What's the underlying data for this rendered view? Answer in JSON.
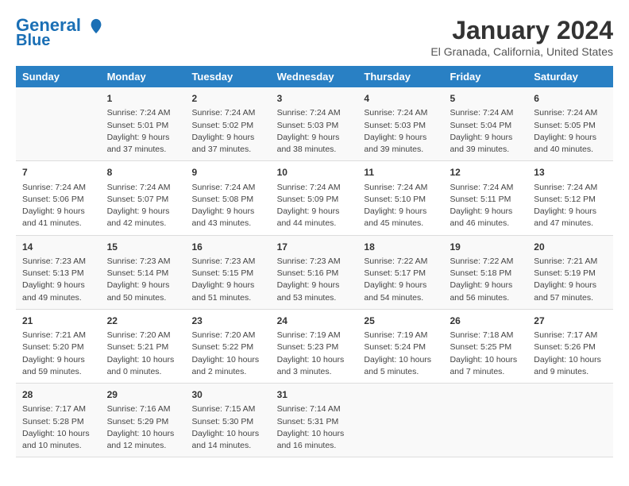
{
  "header": {
    "logo_line1": "General",
    "logo_line2": "Blue",
    "month": "January 2024",
    "location": "El Granada, California, United States"
  },
  "days_of_week": [
    "Sunday",
    "Monday",
    "Tuesday",
    "Wednesday",
    "Thursday",
    "Friday",
    "Saturday"
  ],
  "weeks": [
    [
      {
        "day": "",
        "sunrise": "",
        "sunset": "",
        "daylight": ""
      },
      {
        "day": "1",
        "sunrise": "Sunrise: 7:24 AM",
        "sunset": "Sunset: 5:01 PM",
        "daylight": "Daylight: 9 hours and 37 minutes."
      },
      {
        "day": "2",
        "sunrise": "Sunrise: 7:24 AM",
        "sunset": "Sunset: 5:02 PM",
        "daylight": "Daylight: 9 hours and 37 minutes."
      },
      {
        "day": "3",
        "sunrise": "Sunrise: 7:24 AM",
        "sunset": "Sunset: 5:03 PM",
        "daylight": "Daylight: 9 hours and 38 minutes."
      },
      {
        "day": "4",
        "sunrise": "Sunrise: 7:24 AM",
        "sunset": "Sunset: 5:03 PM",
        "daylight": "Daylight: 9 hours and 39 minutes."
      },
      {
        "day": "5",
        "sunrise": "Sunrise: 7:24 AM",
        "sunset": "Sunset: 5:04 PM",
        "daylight": "Daylight: 9 hours and 39 minutes."
      },
      {
        "day": "6",
        "sunrise": "Sunrise: 7:24 AM",
        "sunset": "Sunset: 5:05 PM",
        "daylight": "Daylight: 9 hours and 40 minutes."
      }
    ],
    [
      {
        "day": "7",
        "sunrise": "Sunrise: 7:24 AM",
        "sunset": "Sunset: 5:06 PM",
        "daylight": "Daylight: 9 hours and 41 minutes."
      },
      {
        "day": "8",
        "sunrise": "Sunrise: 7:24 AM",
        "sunset": "Sunset: 5:07 PM",
        "daylight": "Daylight: 9 hours and 42 minutes."
      },
      {
        "day": "9",
        "sunrise": "Sunrise: 7:24 AM",
        "sunset": "Sunset: 5:08 PM",
        "daylight": "Daylight: 9 hours and 43 minutes."
      },
      {
        "day": "10",
        "sunrise": "Sunrise: 7:24 AM",
        "sunset": "Sunset: 5:09 PM",
        "daylight": "Daylight: 9 hours and 44 minutes."
      },
      {
        "day": "11",
        "sunrise": "Sunrise: 7:24 AM",
        "sunset": "Sunset: 5:10 PM",
        "daylight": "Daylight: 9 hours and 45 minutes."
      },
      {
        "day": "12",
        "sunrise": "Sunrise: 7:24 AM",
        "sunset": "Sunset: 5:11 PM",
        "daylight": "Daylight: 9 hours and 46 minutes."
      },
      {
        "day": "13",
        "sunrise": "Sunrise: 7:24 AM",
        "sunset": "Sunset: 5:12 PM",
        "daylight": "Daylight: 9 hours and 47 minutes."
      }
    ],
    [
      {
        "day": "14",
        "sunrise": "Sunrise: 7:23 AM",
        "sunset": "Sunset: 5:13 PM",
        "daylight": "Daylight: 9 hours and 49 minutes."
      },
      {
        "day": "15",
        "sunrise": "Sunrise: 7:23 AM",
        "sunset": "Sunset: 5:14 PM",
        "daylight": "Daylight: 9 hours and 50 minutes."
      },
      {
        "day": "16",
        "sunrise": "Sunrise: 7:23 AM",
        "sunset": "Sunset: 5:15 PM",
        "daylight": "Daylight: 9 hours and 51 minutes."
      },
      {
        "day": "17",
        "sunrise": "Sunrise: 7:23 AM",
        "sunset": "Sunset: 5:16 PM",
        "daylight": "Daylight: 9 hours and 53 minutes."
      },
      {
        "day": "18",
        "sunrise": "Sunrise: 7:22 AM",
        "sunset": "Sunset: 5:17 PM",
        "daylight": "Daylight: 9 hours and 54 minutes."
      },
      {
        "day": "19",
        "sunrise": "Sunrise: 7:22 AM",
        "sunset": "Sunset: 5:18 PM",
        "daylight": "Daylight: 9 hours and 56 minutes."
      },
      {
        "day": "20",
        "sunrise": "Sunrise: 7:21 AM",
        "sunset": "Sunset: 5:19 PM",
        "daylight": "Daylight: 9 hours and 57 minutes."
      }
    ],
    [
      {
        "day": "21",
        "sunrise": "Sunrise: 7:21 AM",
        "sunset": "Sunset: 5:20 PM",
        "daylight": "Daylight: 9 hours and 59 minutes."
      },
      {
        "day": "22",
        "sunrise": "Sunrise: 7:20 AM",
        "sunset": "Sunset: 5:21 PM",
        "daylight": "Daylight: 10 hours and 0 minutes."
      },
      {
        "day": "23",
        "sunrise": "Sunrise: 7:20 AM",
        "sunset": "Sunset: 5:22 PM",
        "daylight": "Daylight: 10 hours and 2 minutes."
      },
      {
        "day": "24",
        "sunrise": "Sunrise: 7:19 AM",
        "sunset": "Sunset: 5:23 PM",
        "daylight": "Daylight: 10 hours and 3 minutes."
      },
      {
        "day": "25",
        "sunrise": "Sunrise: 7:19 AM",
        "sunset": "Sunset: 5:24 PM",
        "daylight": "Daylight: 10 hours and 5 minutes."
      },
      {
        "day": "26",
        "sunrise": "Sunrise: 7:18 AM",
        "sunset": "Sunset: 5:25 PM",
        "daylight": "Daylight: 10 hours and 7 minutes."
      },
      {
        "day": "27",
        "sunrise": "Sunrise: 7:17 AM",
        "sunset": "Sunset: 5:26 PM",
        "daylight": "Daylight: 10 hours and 9 minutes."
      }
    ],
    [
      {
        "day": "28",
        "sunrise": "Sunrise: 7:17 AM",
        "sunset": "Sunset: 5:28 PM",
        "daylight": "Daylight: 10 hours and 10 minutes."
      },
      {
        "day": "29",
        "sunrise": "Sunrise: 7:16 AM",
        "sunset": "Sunset: 5:29 PM",
        "daylight": "Daylight: 10 hours and 12 minutes."
      },
      {
        "day": "30",
        "sunrise": "Sunrise: 7:15 AM",
        "sunset": "Sunset: 5:30 PM",
        "daylight": "Daylight: 10 hours and 14 minutes."
      },
      {
        "day": "31",
        "sunrise": "Sunrise: 7:14 AM",
        "sunset": "Sunset: 5:31 PM",
        "daylight": "Daylight: 10 hours and 16 minutes."
      },
      {
        "day": "",
        "sunrise": "",
        "sunset": "",
        "daylight": ""
      },
      {
        "day": "",
        "sunrise": "",
        "sunset": "",
        "daylight": ""
      },
      {
        "day": "",
        "sunrise": "",
        "sunset": "",
        "daylight": ""
      }
    ]
  ]
}
